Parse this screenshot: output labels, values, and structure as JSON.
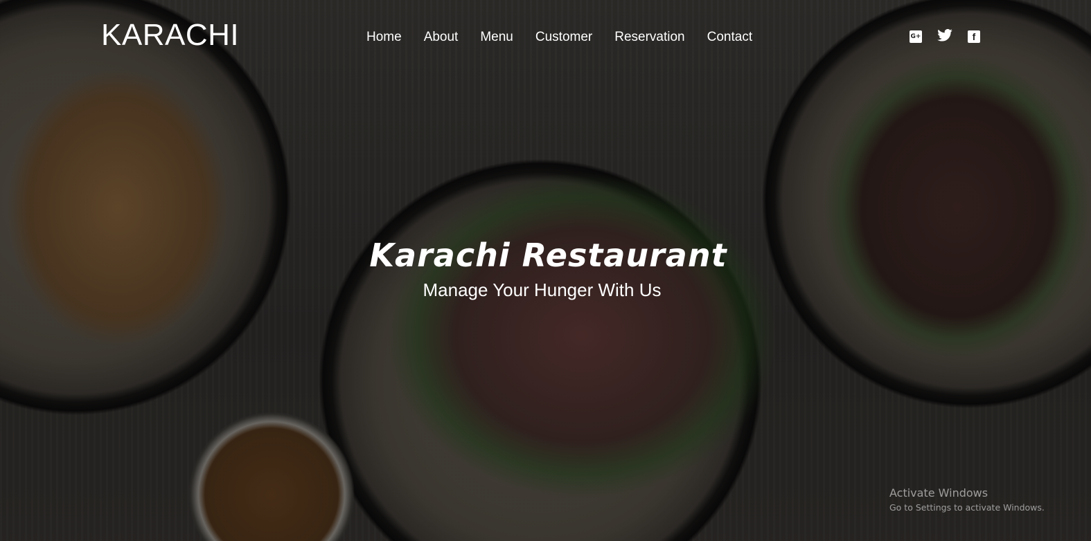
{
  "header": {
    "logo": "KARACHI",
    "nav": [
      "Home",
      "About",
      "Menu",
      "Customer",
      "Reservation",
      "Contact"
    ],
    "social": [
      {
        "icon": "google-plus-icon",
        "label": "G+"
      },
      {
        "icon": "twitter-icon"
      },
      {
        "icon": "facebook-icon",
        "label": "f"
      }
    ]
  },
  "hero": {
    "title": "Karachi Restaurant",
    "subtitle": "Manage Your Hunger With Us"
  },
  "watermark": {
    "title": "Activate Windows",
    "subtitle": "Go to Settings to activate Windows."
  }
}
